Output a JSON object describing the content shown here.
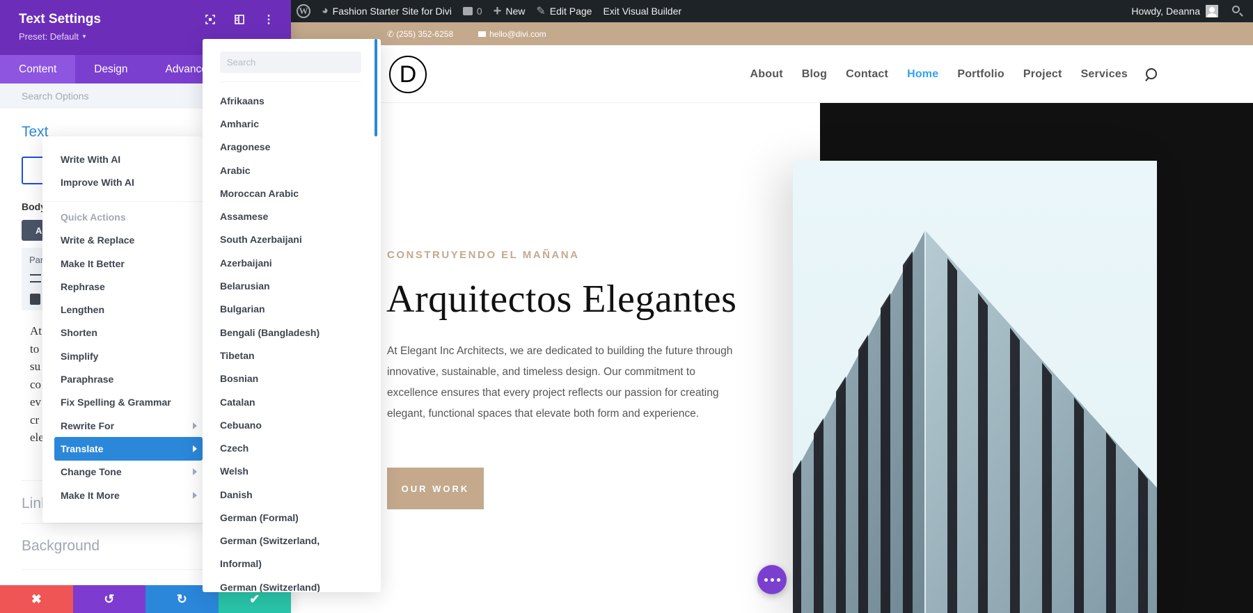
{
  "admin_bar": {
    "site_name": "Fashion Starter Site for Divi",
    "comments_count": "0",
    "new_label": "New",
    "edit_page_label": "Edit Page",
    "exit_builder_label": "Exit Visual Builder",
    "greeting": "Howdy, Deanna"
  },
  "top_bar": {
    "phone": "(255) 352-6258",
    "email": "hello@divi.com"
  },
  "site_header": {
    "logo_letter": "D",
    "nav": [
      {
        "label": "About",
        "active": false
      },
      {
        "label": "Blog",
        "active": false
      },
      {
        "label": "Contact",
        "active": false
      },
      {
        "label": "Home",
        "active": true
      },
      {
        "label": "Portfolio",
        "active": false
      },
      {
        "label": "Project",
        "active": false
      },
      {
        "label": "Services",
        "active": false
      }
    ],
    "active_color": "#2ea3f2"
  },
  "hero": {
    "eyebrow": "CONSTRUYENDO EL MAÑANA",
    "title": "Arquitectos Elegantes",
    "body": "At Elegant Inc Architects, we are dedicated to building the future through innovative, sustainable, and timeless design. Our commitment to excellence ensures that every project reflects our passion for creating elegant, functional spaces that elevate both form and experience.",
    "button_label": "OUR WORK",
    "accent_color": "#c4a98d"
  },
  "settings_panel": {
    "title": "Text Settings",
    "preset": "Preset: Default",
    "tabs": [
      {
        "label": "Content",
        "active": true
      },
      {
        "label": "Design",
        "active": false
      },
      {
        "label": "Advanced",
        "active": false
      }
    ],
    "search_placeholder": "Search Options",
    "section_text_heading": "Text",
    "body_label": "Body",
    "body_button_partial": "A",
    "paragraph_label_partial": "Par",
    "editor_preview_lines": [
      "At",
      "to",
      "su",
      "co",
      "ev",
      "cr",
      "ele"
    ],
    "section_link": "Link",
    "section_background": "Background",
    "brand_color": "#6c2eb9"
  },
  "ai_menu": {
    "top_items": [
      "Write With AI",
      "Improve With AI"
    ],
    "quick_actions_heading": "Quick Actions",
    "actions": [
      {
        "label": "Write & Replace",
        "submenu": false,
        "active": false
      },
      {
        "label": "Make It Better",
        "submenu": false,
        "active": false
      },
      {
        "label": "Rephrase",
        "submenu": false,
        "active": false
      },
      {
        "label": "Lengthen",
        "submenu": false,
        "active": false
      },
      {
        "label": "Shorten",
        "submenu": false,
        "active": false
      },
      {
        "label": "Simplify",
        "submenu": false,
        "active": false
      },
      {
        "label": "Paraphrase",
        "submenu": false,
        "active": false
      },
      {
        "label": "Fix Spelling & Grammar",
        "submenu": false,
        "active": false
      },
      {
        "label": "Rewrite For",
        "submenu": true,
        "active": false
      },
      {
        "label": "Translate",
        "submenu": true,
        "active": true
      },
      {
        "label": "Change Tone",
        "submenu": true,
        "active": false
      },
      {
        "label": "Make It More",
        "submenu": true,
        "active": false
      }
    ],
    "active_color": "#2b87da"
  },
  "language_menu": {
    "search_placeholder": "Search",
    "languages": [
      "Afrikaans",
      "Amharic",
      "Aragonese",
      "Arabic",
      "Moroccan Arabic",
      "Assamese",
      "South Azerbaijani",
      "Azerbaijani",
      "Belarusian",
      "Bulgarian",
      "Bengali (Bangladesh)",
      "Tibetan",
      "Bosnian",
      "Catalan",
      "Cebuano",
      "Czech",
      "Welsh",
      "Danish",
      "German (Formal)",
      "German (Switzerland, Informal)",
      "German (Switzerland)"
    ]
  },
  "footer_actions": {
    "cancel": "close-icon",
    "undo": "undo-icon",
    "redo": "redo-icon",
    "save": "check-icon"
  }
}
